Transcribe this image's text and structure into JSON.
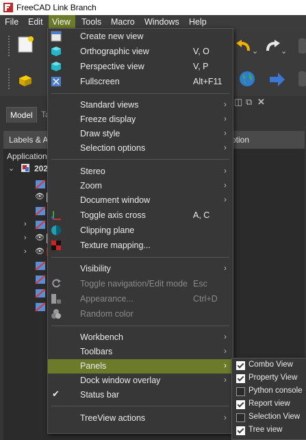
{
  "window": {
    "title": "FreeCAD Link Branch"
  },
  "menubar": [
    "File",
    "Edit",
    "View",
    "Tools",
    "Macro",
    "Windows",
    "Help"
  ],
  "panel": {
    "tabs": [
      "Model",
      "Ta"
    ],
    "header_left": "Labels & A",
    "header_right": "ption",
    "app_label": "Application",
    "doc_label": "202"
  },
  "view_menu": {
    "items": [
      {
        "label": "Create new view",
        "shortcut": "",
        "icon": "new-view-icon"
      },
      {
        "label": "Orthographic view",
        "shortcut": "V, O",
        "icon": "cube-icon"
      },
      {
        "label": "Perspective view",
        "shortcut": "V, P",
        "icon": "cube-icon"
      },
      {
        "label": "Fullscreen",
        "shortcut": "Alt+F11",
        "icon": "fullscreen-icon"
      },
      {
        "label": "Standard views",
        "submenu": true
      },
      {
        "label": "Freeze display",
        "submenu": true
      },
      {
        "label": "Draw style",
        "submenu": true
      },
      {
        "label": "Selection options",
        "submenu": true
      },
      {
        "label": "Stereo",
        "submenu": true
      },
      {
        "label": "Zoom",
        "submenu": true
      },
      {
        "label": "Document window",
        "submenu": true
      },
      {
        "label": "Toggle axis cross",
        "shortcut": "A, C",
        "icon": "axis-icon"
      },
      {
        "label": "Clipping plane",
        "icon": "clipping-icon"
      },
      {
        "label": "Texture mapping...",
        "icon": "texture-icon"
      },
      {
        "label": "Visibility",
        "submenu": true
      },
      {
        "label": "Toggle navigation/Edit mode",
        "shortcut": "Esc",
        "icon": "navigation-icon",
        "disabled": true
      },
      {
        "label": "Appearance...",
        "shortcut": "Ctrl+D",
        "icon": "appearance-icon",
        "disabled": true
      },
      {
        "label": "Random color",
        "icon": "random-color-icon",
        "disabled": true
      },
      {
        "label": "Workbench",
        "submenu": true
      },
      {
        "label": "Toolbars",
        "submenu": true
      },
      {
        "label": "Panels",
        "submenu": true,
        "highlighted": true
      },
      {
        "label": "Dock window overlay",
        "submenu": true
      },
      {
        "label": "Status bar",
        "checked": true
      },
      {
        "label": "TreeView actions",
        "submenu": true
      }
    ]
  },
  "panels_submenu": {
    "items": [
      {
        "label": "Combo View",
        "checked": true
      },
      {
        "label": "Property View",
        "checked": true
      },
      {
        "label": "Python console",
        "checked": false
      },
      {
        "label": "Report view",
        "checked": true
      },
      {
        "label": "Selection View",
        "checked": false
      },
      {
        "label": "Tree view",
        "checked": true
      }
    ]
  },
  "colors": {
    "accent": "#6b7b2a",
    "menu_bg": "#373737",
    "toolbar_bg": "#3b3b3b"
  }
}
